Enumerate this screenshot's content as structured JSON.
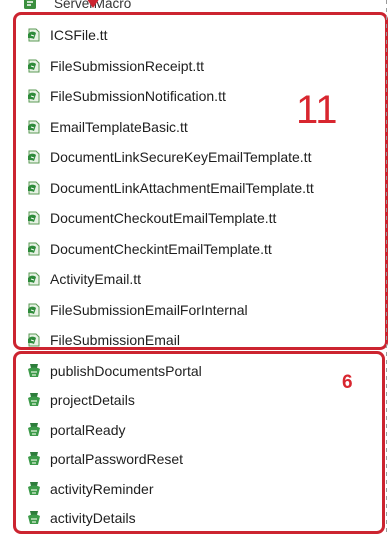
{
  "header": {
    "partial_label": "ServerMacro"
  },
  "group_templates": {
    "count": "11",
    "items": [
      {
        "label": "ICSFile.tt",
        "icon": "template-file-icon"
      },
      {
        "label": "FileSubmissionReceipt.tt",
        "icon": "template-file-icon"
      },
      {
        "label": "FileSubmissionNotification.tt",
        "icon": "template-file-icon"
      },
      {
        "label": "EmailTemplateBasic.tt",
        "icon": "template-file-icon"
      },
      {
        "label": "DocumentLinkSecureKeyEmailTemplate.tt",
        "icon": "template-file-icon"
      },
      {
        "label": "DocumentLinkAttachmentEmailTemplate.tt",
        "icon": "template-file-icon"
      },
      {
        "label": "DocumentCheckoutEmailTemplate.tt",
        "icon": "template-file-icon"
      },
      {
        "label": "DocumentCheckintEmailTemplate.tt",
        "icon": "template-file-icon"
      },
      {
        "label": "ActivityEmail.tt",
        "icon": "template-file-icon"
      },
      {
        "label": "FileSubmissionEmailForInternal",
        "icon": "template-file-icon"
      },
      {
        "label": "FileSubmissionEmail",
        "icon": "template-file-icon"
      }
    ]
  },
  "group_portal": {
    "count": "6",
    "items": [
      {
        "label": "publishDocumentsPortal",
        "icon": "portal-template-icon"
      },
      {
        "label": "projectDetails",
        "icon": "portal-template-icon"
      },
      {
        "label": "portalReady",
        "icon": "portal-template-icon"
      },
      {
        "label": "portalPasswordReset",
        "icon": "portal-template-icon"
      },
      {
        "label": "activityReminder",
        "icon": "portal-template-icon"
      },
      {
        "label": "activityDetails",
        "icon": "portal-template-icon"
      }
    ]
  },
  "colors": {
    "highlight": "#cc2430",
    "icon_green": "#2e8b3a",
    "text": "#1e1e1e"
  }
}
